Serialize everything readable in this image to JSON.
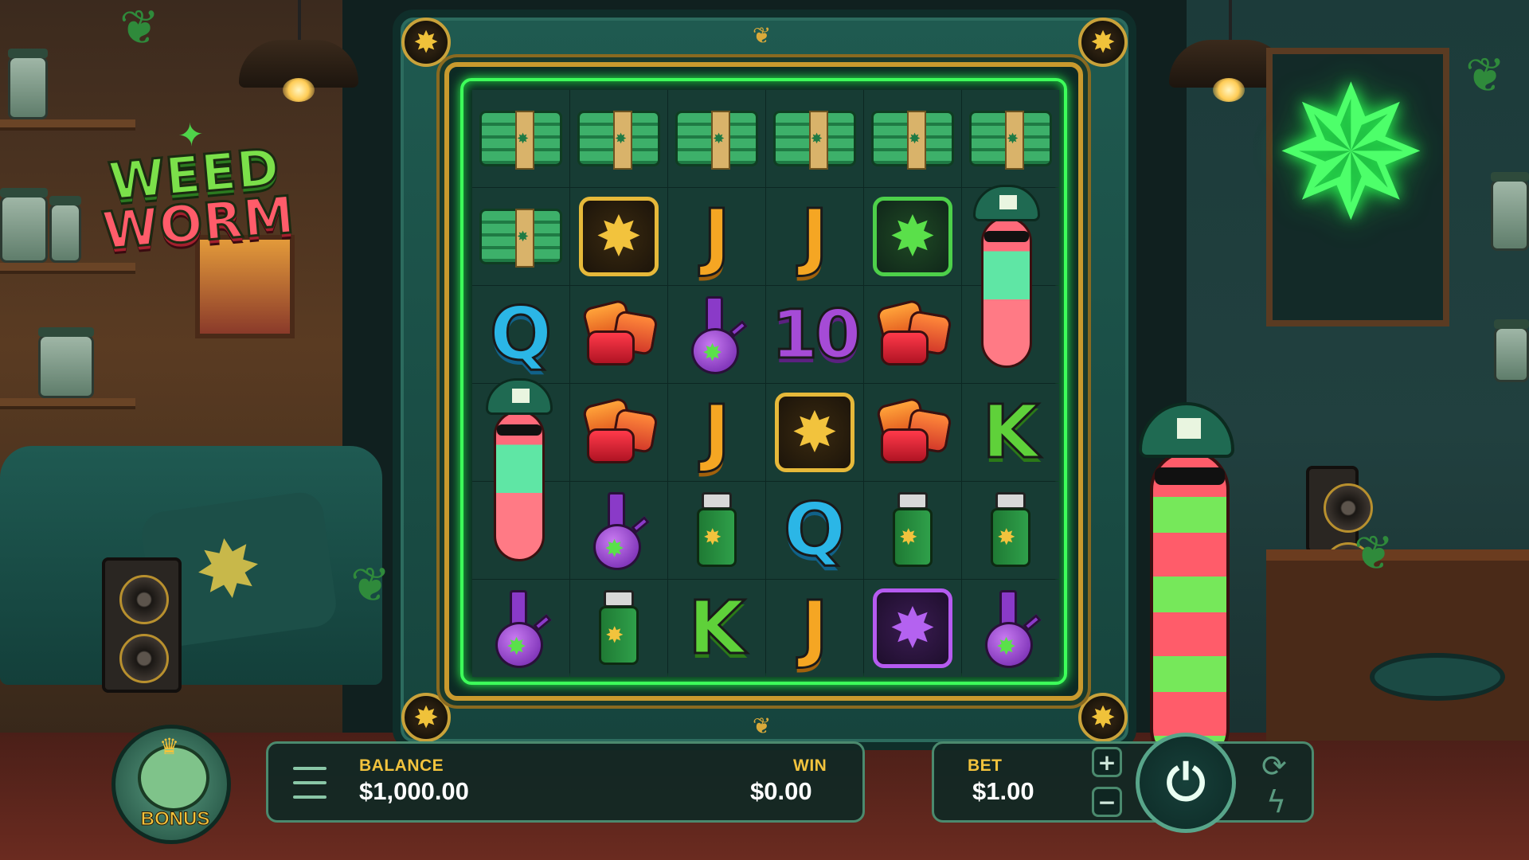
{
  "game": {
    "logo_line1": "WEED",
    "logo_line2": "WORM"
  },
  "reels": {
    "rows": [
      [
        "cash",
        "cash",
        "cash",
        "cash",
        "cash",
        "cash"
      ],
      [
        "cash",
        "gold-leaf",
        "J",
        "J",
        "green-leaf",
        "worm-top"
      ],
      [
        "Q",
        "gummy",
        "bong",
        "10",
        "gummy",
        "worm-body"
      ],
      [
        "worm-top",
        "gummy",
        "J",
        "gold-leaf",
        "gummy",
        "K"
      ],
      [
        "worm-body",
        "bong",
        "lighter",
        "Q",
        "lighter",
        "lighter"
      ],
      [
        "bong",
        "lighter",
        "K",
        "J",
        "purple-leaf",
        "bong"
      ]
    ]
  },
  "hud": {
    "balance_label": "BALANCE",
    "balance_value": "$1,000.00",
    "win_label": "WIN",
    "win_value": "$0.00",
    "bet_label": "BET",
    "bet_value": "$1.00",
    "plus": "+",
    "minus": "−",
    "spin_glyph": "⏻",
    "autoplay_glyph": "⟳",
    "turbo_glyph": "ϟ",
    "bonus_label": "BONUS"
  },
  "colors": {
    "accent_gold": "#f2c33d",
    "neon_green": "#3dff5a",
    "panel_border": "#4b8a6e"
  },
  "icons": {
    "menu": "hamburger-menu-icon",
    "spin": "spin-icon",
    "autoplay": "autoplay-icon",
    "turbo": "turbo-lightning-icon"
  }
}
